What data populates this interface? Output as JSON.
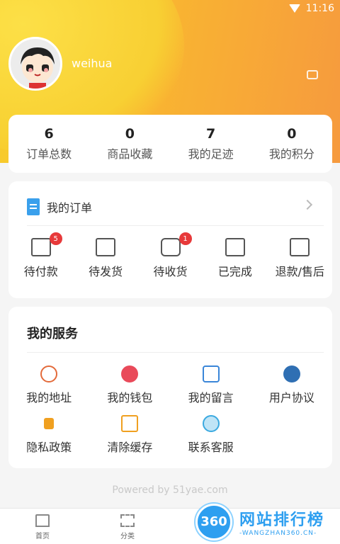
{
  "status_bar": {
    "time": "11:16"
  },
  "profile": {
    "username": "weihua"
  },
  "stats": [
    {
      "value": "6",
      "label": "订单总数"
    },
    {
      "value": "0",
      "label": "商品收藏"
    },
    {
      "value": "7",
      "label": "我的足迹"
    },
    {
      "value": "0",
      "label": "我的积分"
    }
  ],
  "orders": {
    "title": "我的订单",
    "items": [
      {
        "label": "待付款",
        "badge": "5",
        "icon": "wallet-icon"
      },
      {
        "label": "待发货",
        "badge": "",
        "icon": "box-icon"
      },
      {
        "label": "待收货",
        "badge": "1",
        "icon": "truck-icon"
      },
      {
        "label": "已完成",
        "badge": "",
        "icon": "clipboard-check-icon"
      },
      {
        "label": "退款/售后",
        "badge": "",
        "icon": "refund-icon"
      }
    ]
  },
  "services": {
    "title": "我的服务",
    "items": [
      {
        "label": "我的地址",
        "icon": "location-pin-icon",
        "color": "#e36a3a"
      },
      {
        "label": "我的钱包",
        "icon": "money-bag-icon",
        "color": "#e94a5a"
      },
      {
        "label": "我的留言",
        "icon": "chat-bubble-icon",
        "color": "#3a86d8"
      },
      {
        "label": "用户协议",
        "icon": "handshake-icon",
        "color": "#2f6fb3"
      },
      {
        "label": "隐私政策",
        "icon": "lock-icon",
        "color": "#f0a020"
      },
      {
        "label": "清除缓存",
        "icon": "broom-icon",
        "color": "#f0a020"
      },
      {
        "label": "联系客服",
        "icon": "headset-icon",
        "color": "#3aa9e0"
      }
    ]
  },
  "footer": {
    "powered": "Powered by 51yae.com"
  },
  "tabbar": [
    {
      "label": "首页",
      "icon": "home-icon"
    },
    {
      "label": "分类",
      "icon": "grid-icon"
    }
  ],
  "watermark": {
    "badge": "360",
    "title": "网站排行榜",
    "subtitle": "-WANGZHAN360.CN-"
  }
}
